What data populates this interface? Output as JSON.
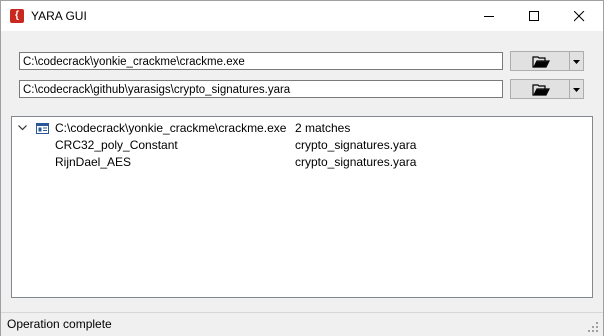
{
  "window": {
    "title": "YARA GUI",
    "app_icon_glyph": "{",
    "app_icon_name": "yara-app-icon",
    "accent_color": "#c8281e"
  },
  "inputs": {
    "target_path": "C:\\codecrack\\yonkie_crackme\\crackme.exe",
    "rules_path": "C:\\codecrack\\github\\yarasigs\\crypto_signatures.yara"
  },
  "buttons": {
    "browse_icon": "folder-open-icon",
    "dropdown_icon": "chevron-down-icon"
  },
  "results": {
    "file": {
      "path": "C:\\codecrack\\yonkie_crackme\\crackme.exe",
      "summary": "2 matches",
      "expanded": true
    },
    "matches": [
      {
        "rule": "CRC32_poly_Constant",
        "source": "crypto_signatures.yara"
      },
      {
        "rule": "RijnDael_AES",
        "source": "crypto_signatures.yara"
      }
    ]
  },
  "status": {
    "text": "Operation complete"
  }
}
